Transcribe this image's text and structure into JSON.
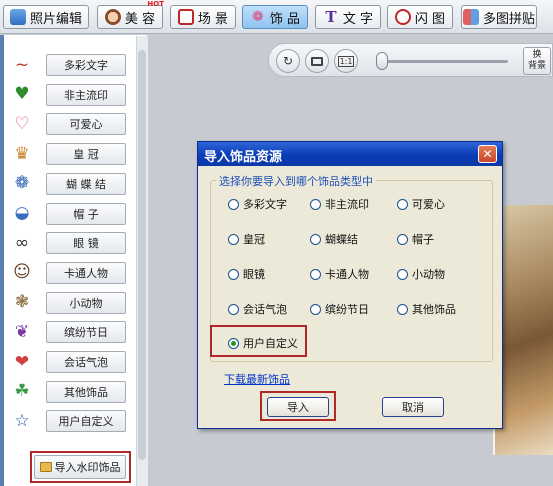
{
  "toolbar": {
    "photo_edit": "照片编辑",
    "beauty": "美 容",
    "beauty_badge": "HOT",
    "scene": "场 景",
    "accessory": "饰 品",
    "text": "文 字",
    "flash": "闪 图",
    "collage": "多图拼贴"
  },
  "controls": {
    "swap_bg_line1": "换",
    "swap_bg_line2": "背景",
    "ratio_label": "1:1"
  },
  "sidebar": {
    "items": [
      {
        "label": "多彩文字",
        "icon": "colorful-text-icon",
        "glyph": "~"
      },
      {
        "label": "非主流印",
        "icon": "heart-stamp-icon",
        "glyph": "♥"
      },
      {
        "label": "可爱心",
        "icon": "heart-outline-icon",
        "glyph": "♡"
      },
      {
        "label": "皇  冠",
        "icon": "crown-icon",
        "glyph": "♛"
      },
      {
        "label": "蝴 蝶 结",
        "icon": "bow-icon",
        "glyph": "❁"
      },
      {
        "label": "帽  子",
        "icon": "hat-icon",
        "glyph": "◒"
      },
      {
        "label": "眼  镜",
        "icon": "glasses-icon",
        "glyph": "∞"
      },
      {
        "label": "卡通人物",
        "icon": "cartoon-face-icon",
        "glyph": "☺"
      },
      {
        "label": "小动物",
        "icon": "animal-icon",
        "glyph": "❃"
      },
      {
        "label": "缤纷节日",
        "icon": "gift-icon",
        "glyph": "❦"
      },
      {
        "label": "会话气泡",
        "icon": "love-bubble-icon",
        "glyph": "❤"
      },
      {
        "label": "其他饰品",
        "icon": "leaf-icon",
        "glyph": "☘"
      },
      {
        "label": "用户自定义",
        "icon": "star-outline-icon",
        "glyph": "☆"
      }
    ],
    "import_button": "导入水印饰品"
  },
  "dialog": {
    "title": "导入饰品资源",
    "close": "✕",
    "group_legend": "选择你要导入到哪个饰品类型中",
    "options": [
      "多彩文字",
      "非主流印",
      "可爱心",
      "皇冠",
      "蝴蝶结",
      "帽子",
      "眼镜",
      "卡通人物",
      "小动物",
      "会话气泡",
      "缤纷节日",
      "其他饰品",
      "用户自定义"
    ],
    "selected": "用户自定义",
    "download_link": "下载最新饰品",
    "import_button": "导入",
    "cancel_button": "取消"
  },
  "colors": {
    "highlight": "#b0282a",
    "title_bar": "#0a3cb7",
    "link": "#0033cc",
    "legend": "#1e4fb8"
  }
}
